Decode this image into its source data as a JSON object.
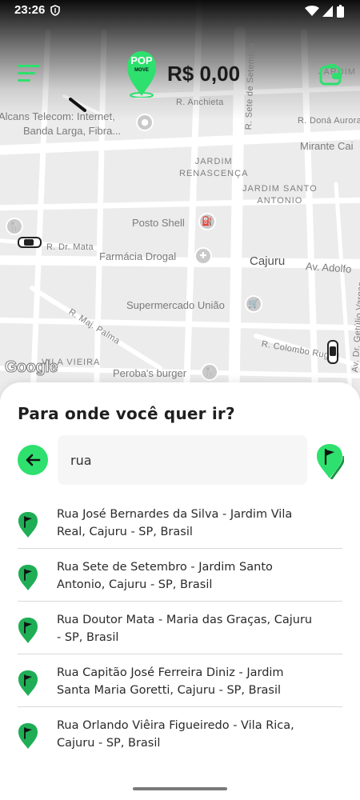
{
  "status_bar": {
    "time": "23:26",
    "icons": [
      "shield-icon",
      "wifi-icon",
      "signal-icon",
      "battery-icon"
    ]
  },
  "header": {
    "logo_text": "POP MOVE",
    "balance": "R$ 0,00",
    "icons": [
      "menu-icon",
      "wallet-icon"
    ]
  },
  "map": {
    "labels": {
      "poi_alcans_1": "Alcans Telecom: Internet,",
      "poi_alcans_2": "Banda Larga, Fibra...",
      "street_anchieta": "R. Anchieta",
      "street_sete": "R. Sete de Setembro",
      "street_dona_aurora": "R. Doná Aurora",
      "mirante": "Mirante Cai",
      "jardim_top": "JARDIM",
      "jardim_renascenca_1": "JARDIM",
      "jardim_renascenca_2": "RENASCENÇA",
      "jardim_santo_1": "JARDIM SANTO",
      "jardim_santo_2": "ANTONIO",
      "posto_shell": "Posto Shell",
      "street_dr_mata": "R. Dr. Mata",
      "farmacia": "Farmácia Drogal",
      "cajuru": "Cajuru",
      "av_adolfo": "Av. Adolfo",
      "supermercado": "Supermercado União",
      "street_maj_palma": "R. Maj. Palma",
      "street_getulio": "Av. Dr. Getúlio Vargas",
      "street_colombo": "R. Colombo Rugeri",
      "vila_vieira": "VILA VIEIRA",
      "perobas": "Peroba's burger",
      "google": "Google"
    }
  },
  "sheet": {
    "title": "Para onde você quer ir?",
    "search_value": "rua",
    "results": [
      {
        "line1": "Rua José Bernardes da Silva - Jardim Vila",
        "line2": "Real, Cajuru - SP, Brasil"
      },
      {
        "line1": "Rua Sete de Setembro - Jardim Santo",
        "line2": "Antonio, Cajuru - SP, Brasil"
      },
      {
        "line1": "Rua Doutor Mata - Maria das Graças, Cajuru",
        "line2": "- SP, Brasil"
      },
      {
        "line1": "Rua Capitão José Ferreira Diniz - Jardim",
        "line2": "Santa Maria Goretti, Cajuru - SP, Brasil"
      },
      {
        "line1": "Rua Orlando Viêira Figueiredo - Vila Rica,",
        "line2": "Cajuru - SP, Brasil"
      }
    ]
  },
  "colors": {
    "accent": "#2EE06E",
    "pin_green": "#1FAE55",
    "text_dark": "#1F1F1F",
    "map_bg": "#ECECEC"
  }
}
